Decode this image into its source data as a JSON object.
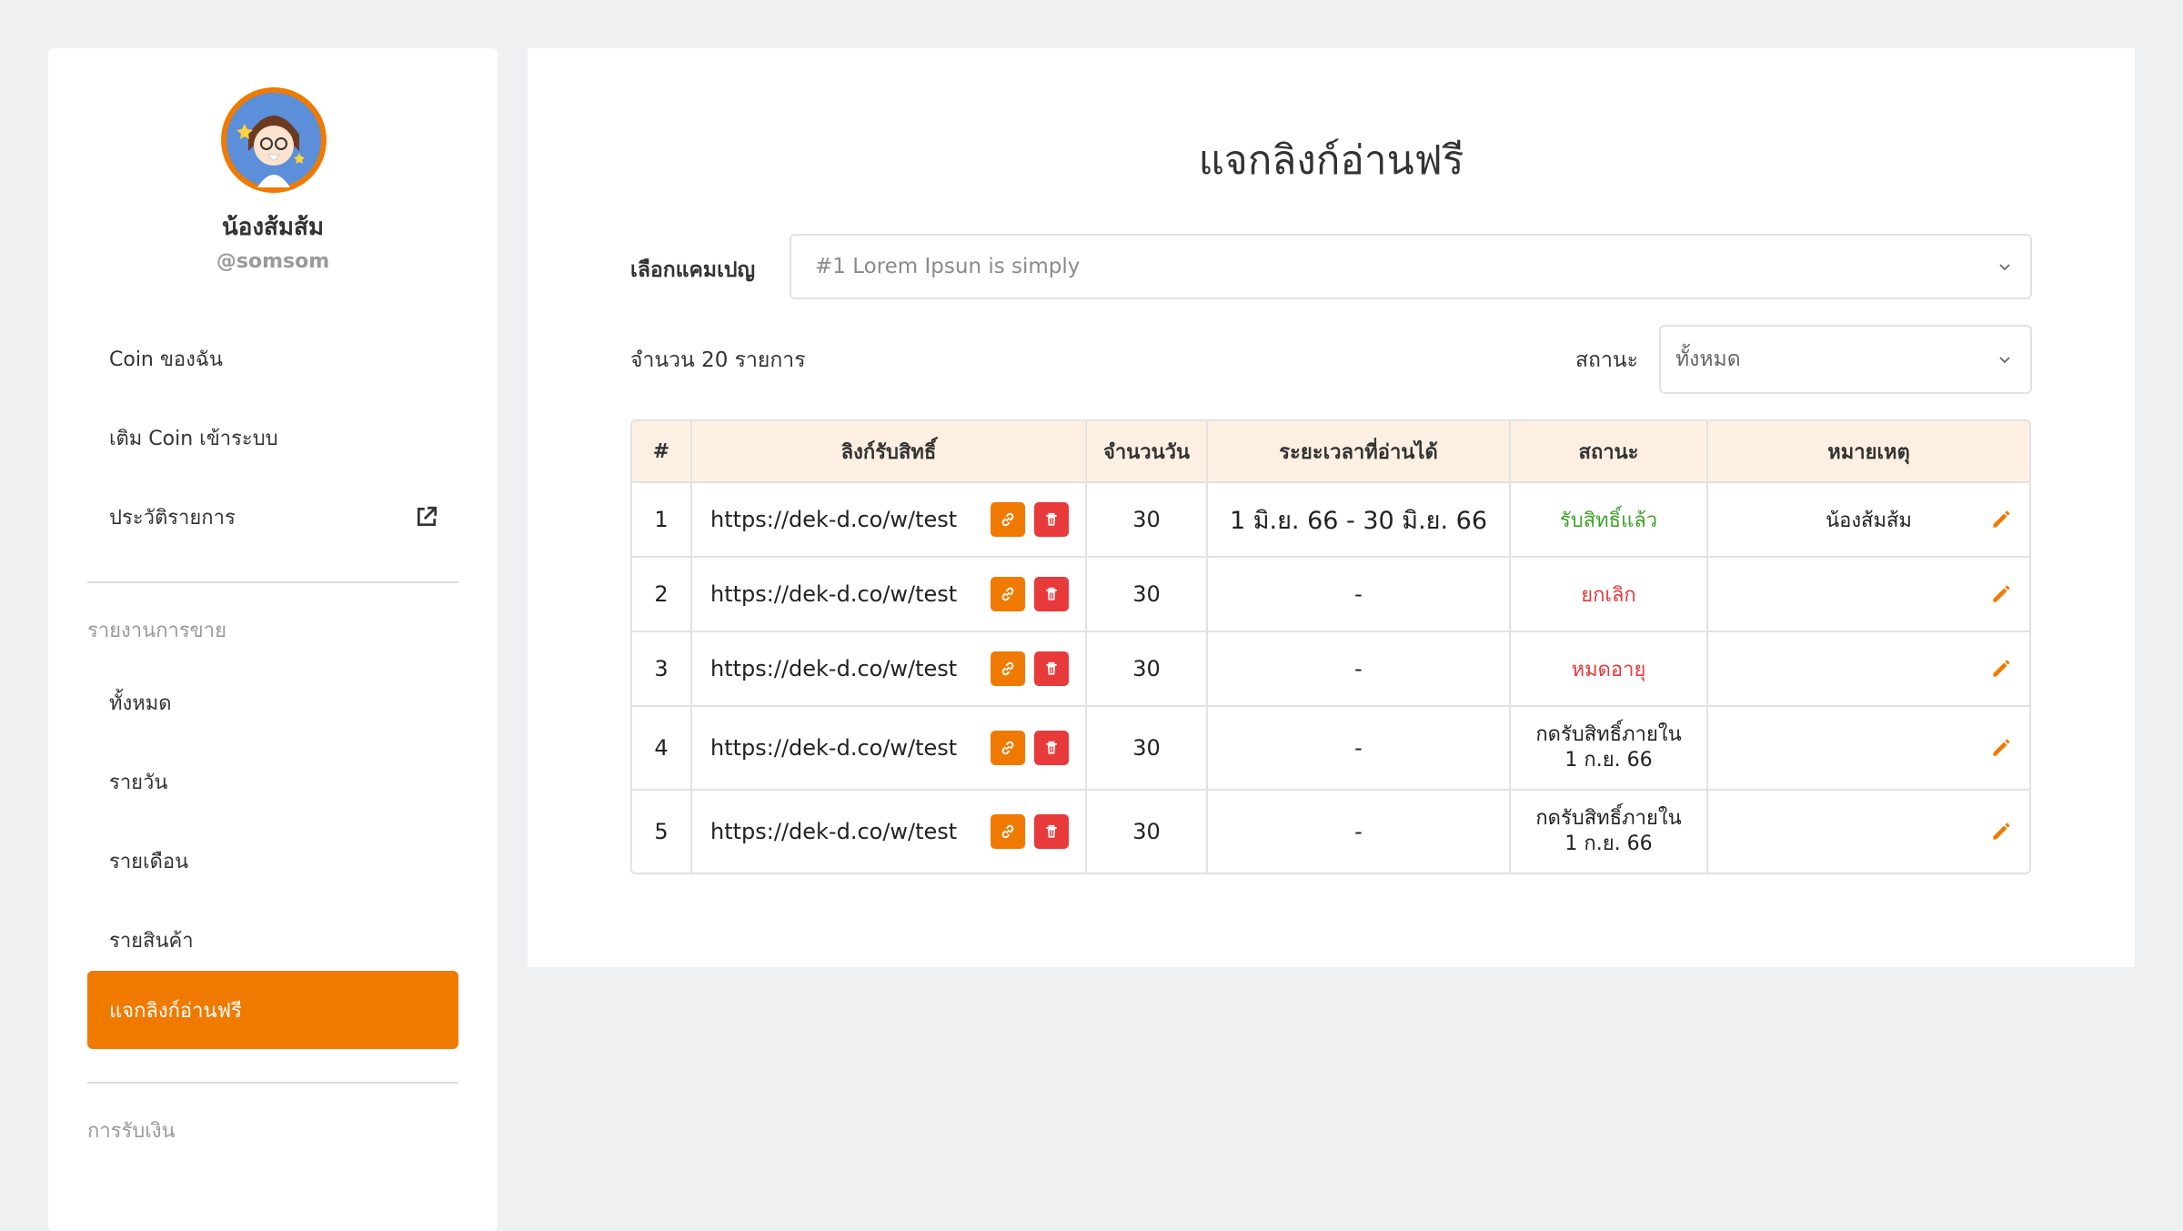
{
  "profile": {
    "name": "น้องส้มส้ม",
    "handle": "@somsom"
  },
  "sidebar": {
    "items_top": [
      {
        "label": "Coin ของฉัน"
      },
      {
        "label": "เติม Coin เข้าระบบ"
      },
      {
        "label": "ประวัติรายการ",
        "icon": "external-link-icon"
      }
    ],
    "sales_section": "รายงานการขาย",
    "sales_items": [
      {
        "label": "ทั้งหมด"
      },
      {
        "label": "รายวัน"
      },
      {
        "label": "รายเดือน"
      },
      {
        "label": "รายสินค้า"
      },
      {
        "label": "แจกลิงก์อ่านฟรี",
        "active": true
      }
    ],
    "payment_section": "การรับเงิน"
  },
  "main": {
    "title": "แจกลิงก์อ่านฟรี",
    "campaign_label": "เลือกแคมเปญ",
    "campaign_value": "#1 Lorem Ipsun is simply",
    "count_text": "จำนวน 20 รายการ",
    "status_label": "สถานะ",
    "status_value": "ทั้งหมด"
  },
  "table": {
    "headers": [
      "#",
      "ลิงก์รับสิทธิ์",
      "จำนวนวัน",
      "ระยะเวลาที่อ่านได้",
      "สถานะ",
      "หมายเหตุ"
    ],
    "rows": [
      {
        "no": "1",
        "link": "https://dek-d.co/w/test",
        "days": "30",
        "period": "1 มิ.ย. 66 - 30 มิ.ย. 66",
        "status": "รับสิทธิ์แล้ว",
        "status_color": "#3fa128",
        "note": "น้องส้มส้ม"
      },
      {
        "no": "2",
        "link": "https://dek-d.co/w/test",
        "days": "30",
        "period": "-",
        "status": "ยกเลิก",
        "status_color": "#e8393b",
        "note": ""
      },
      {
        "no": "3",
        "link": "https://dek-d.co/w/test",
        "days": "30",
        "period": "-",
        "status": "หมดอายุ",
        "status_color": "#e8393b",
        "note": ""
      },
      {
        "no": "4",
        "link": "https://dek-d.co/w/test",
        "days": "30",
        "period": "-",
        "status_line1": "กดรับสิทธิ์ภายใน",
        "status_line2": "1 ก.ย. 66",
        "status_color": "#222222",
        "note": ""
      },
      {
        "no": "5",
        "link": "https://dek-d.co/w/test",
        "days": "30",
        "period": "-",
        "status_line1": "กดรับสิทธิ์ภายใน",
        "status_line2": "1 ก.ย. 66",
        "status_color": "#222222",
        "note": ""
      }
    ]
  },
  "colors": {
    "accent": "#f07a00",
    "danger": "#e8393b",
    "success": "#3fa128",
    "header_bg": "#fdf0e3"
  }
}
